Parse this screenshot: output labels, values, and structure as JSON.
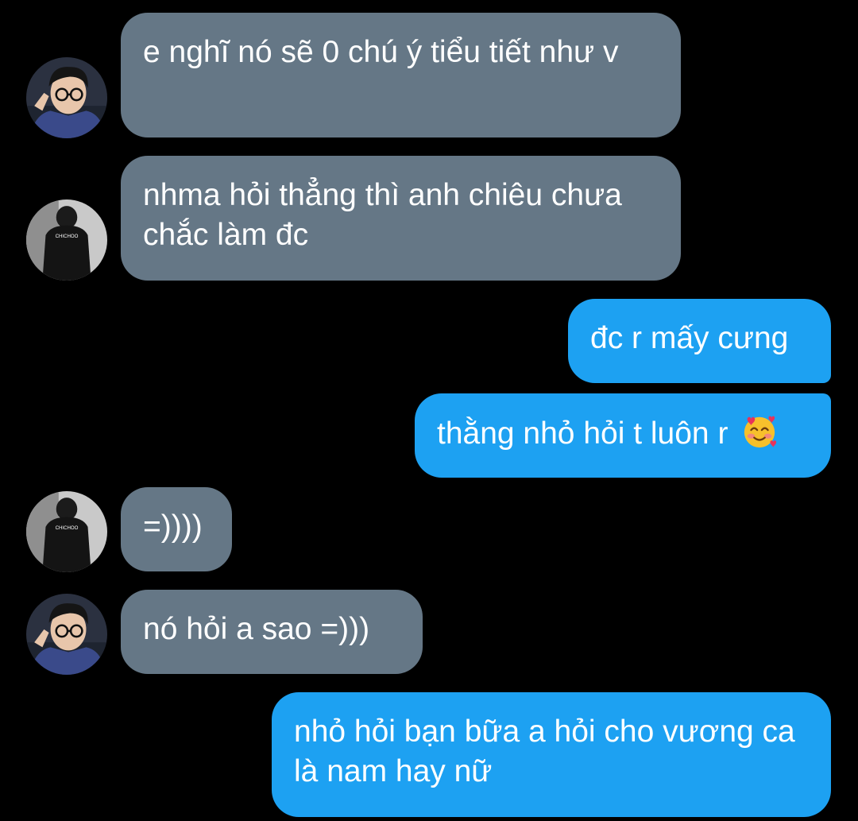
{
  "conversation": {
    "messages": [
      {
        "sender": "other-a",
        "text": "e nghĩ nó sẽ 0 chú ý tiểu tiết như v"
      },
      {
        "sender": "other-b",
        "text": "nhma hỏi thẳng thì anh chiêu chưa chắc làm đc"
      },
      {
        "sender": "me",
        "text": "đc r mấy cưng"
      },
      {
        "sender": "me",
        "text": "thằng nhỏ hỏi t luôn r",
        "emoji": "smiling-face-with-hearts"
      },
      {
        "sender": "other-b",
        "text": "=))))"
      },
      {
        "sender": "other-a",
        "text": "nó hỏi a sao =)))"
      },
      {
        "sender": "me",
        "text": "nhỏ hỏi bạn bữa a hỏi cho vương ca là nam hay nữ"
      }
    ]
  },
  "avatars": {
    "other_b_shirt_text": "CHICHOO"
  },
  "colors": {
    "background": "#000000",
    "received_bubble": "#657786",
    "sent_bubble": "#1da1f2",
    "text": "#ffffff"
  }
}
